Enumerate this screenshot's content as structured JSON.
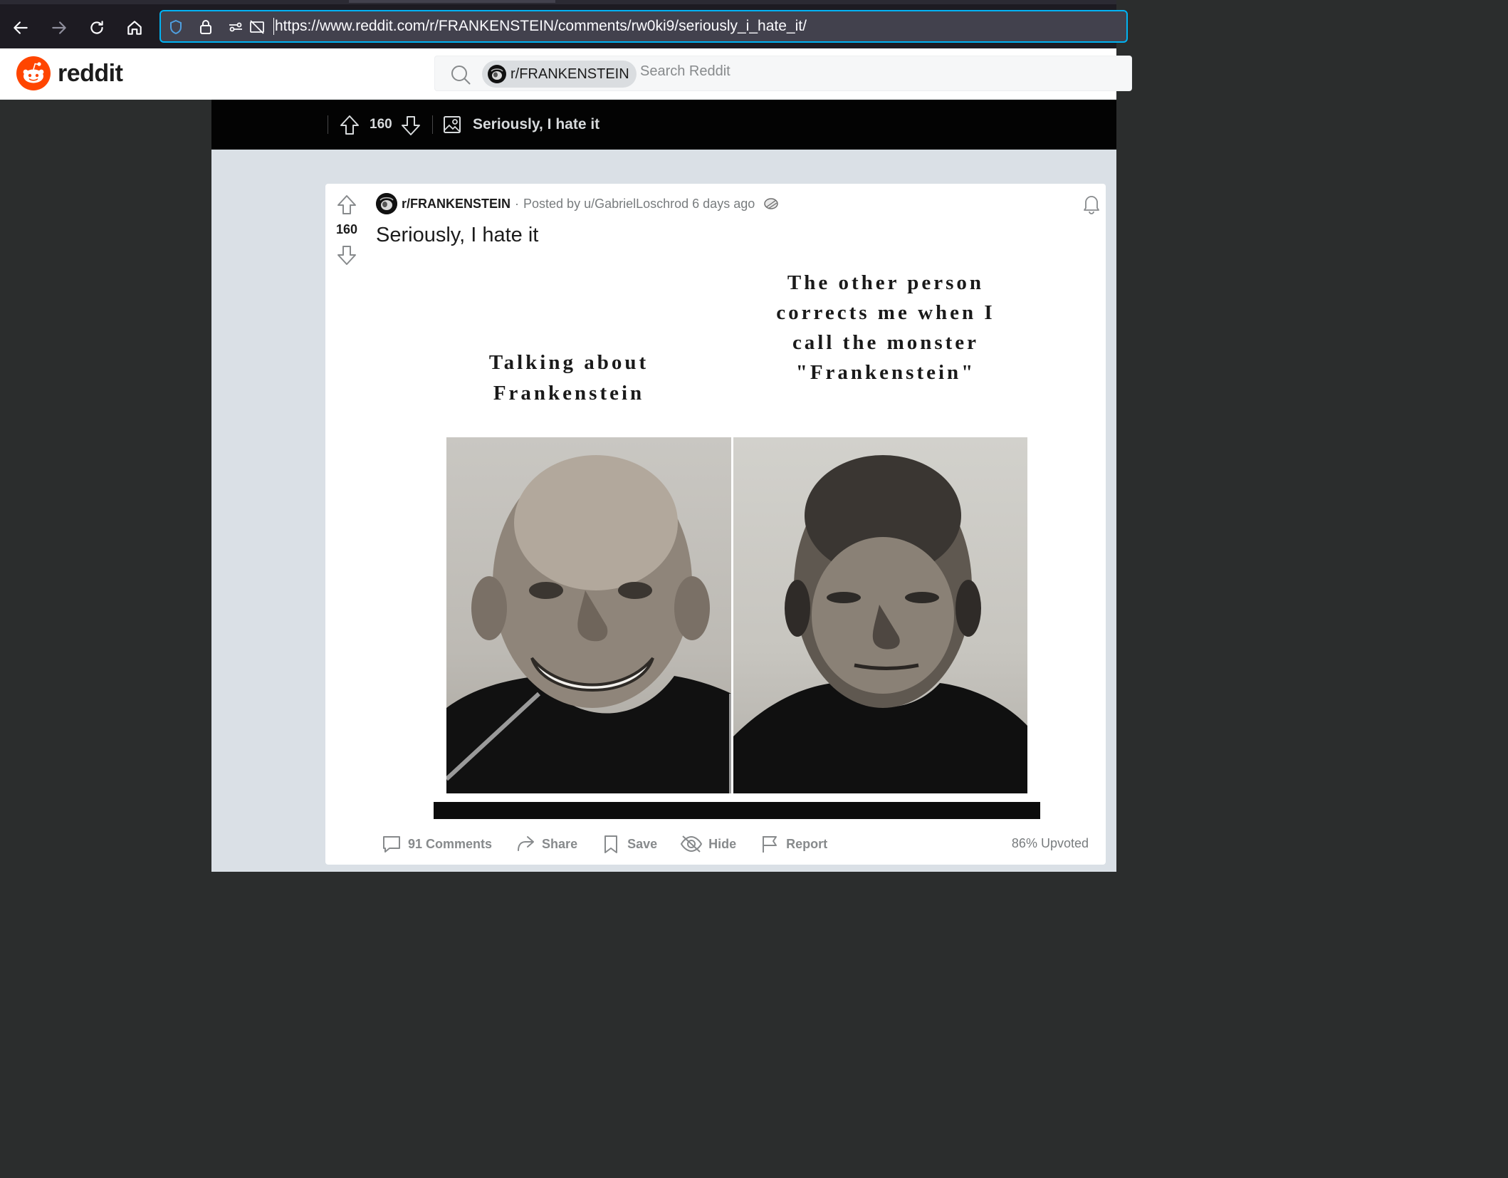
{
  "browser": {
    "url": "https://www.reddit.com/r/FRANKENSTEIN/comments/rw0ki9/seriously_i_hate_it/"
  },
  "header": {
    "logo_text": "reddit",
    "search_chip": "r/FRANKENSTEIN",
    "search_placeholder": "Search Reddit"
  },
  "sticky_bar": {
    "score": "160",
    "title": "Seriously, I hate it"
  },
  "post": {
    "score": "160",
    "subreddit": "r/FRANKENSTEIN",
    "separator": "·",
    "posted_by": "Posted by u/GabrielLoschrod",
    "time": "6 days ago",
    "title": "Seriously, I hate it",
    "meme": {
      "caption_left": "Talking about Frankenstein",
      "caption_right": "The other person corrects me when I call the monster \"Frankenstein\""
    },
    "actions": {
      "comments": "91 Comments",
      "share": "Share",
      "save": "Save",
      "hide": "Hide",
      "report": "Report"
    },
    "upvoted": "86% Upvoted"
  },
  "colors": {
    "reddit_orange": "#ff4500",
    "url_focus": "#00b3f4"
  }
}
